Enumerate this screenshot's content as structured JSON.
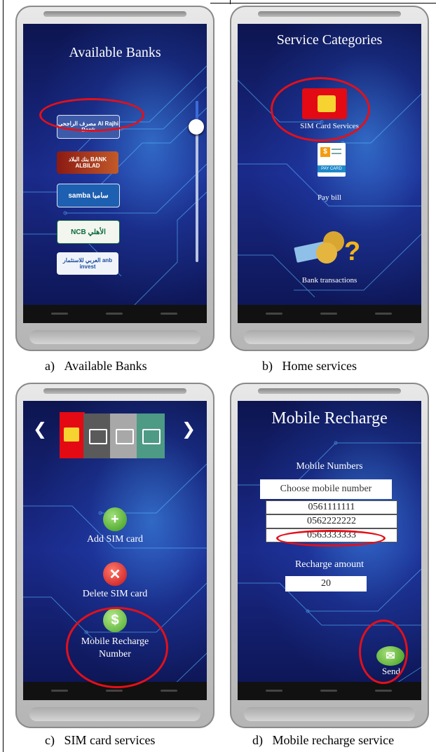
{
  "panels": {
    "a": {
      "title": "Available Banks",
      "caption_letter": "a)",
      "caption": "Available Banks",
      "banks": [
        "مصرف الراجحي Al Rajhi Bank",
        "بنك البلاد BANK ALBILAD",
        "samba سامبا",
        "NCB الأهلي",
        "العربي للاستثمار anb invest"
      ]
    },
    "b": {
      "title": "Service Categories",
      "caption_letter": "b)",
      "caption": "Home services",
      "items": [
        "SIM Card Services",
        "Pay bill",
        "Bank transactions"
      ],
      "paycard_label": "PAY CARD"
    },
    "c": {
      "caption_letter": "c)",
      "caption": "SIM card services",
      "prev": "❮",
      "next": "❯",
      "items": [
        "Add SIM card",
        "Delete SIM card",
        "Mobile Recharge",
        "Number"
      ],
      "dollar": "$"
    },
    "d": {
      "title": "Mobile Recharge",
      "caption_letter": "d)",
      "caption": "Mobile recharge  service",
      "numbers_label": "Mobile Numbers",
      "select_placeholder": "Choose mobile number",
      "numbers": [
        "0561111111",
        "0562222222",
        "0563333333"
      ],
      "amount_label": "Recharge amount",
      "amount": "20",
      "send": "Send"
    }
  },
  "colors": {
    "highlight": "#e3101a",
    "screen_dark": "#0d1550"
  }
}
